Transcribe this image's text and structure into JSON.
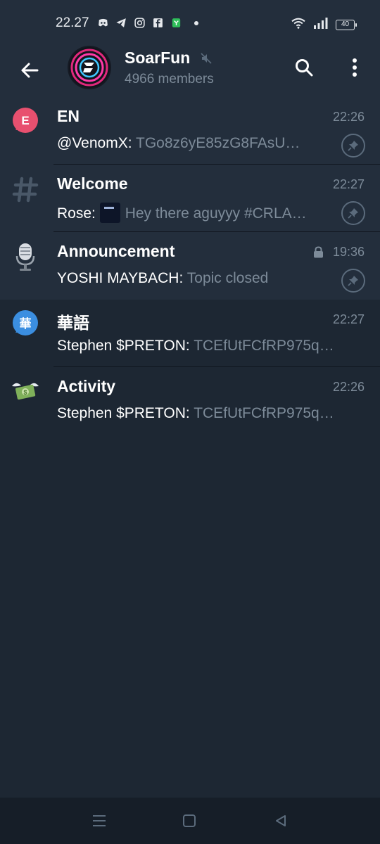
{
  "status_bar": {
    "time": "22.27",
    "left_icons": [
      "discord-icon",
      "telegram-icon",
      "instagram-icon",
      "facebook-icon",
      "app-icon"
    ],
    "battery": "40"
  },
  "header": {
    "title": "SoarFun",
    "members": "4966 members"
  },
  "topics": [
    {
      "title": "EN",
      "time": "22:26",
      "sender": "@VenomX:",
      "message": "TGo8z6yE85zG8FAsU…",
      "pinned": true,
      "icon": "en-bubble-icon",
      "icon_color": "#e8506f",
      "icon_letter": "E"
    },
    {
      "title": "Welcome",
      "time": "22:27",
      "sender": "Rose:",
      "message": "Hey there aguyyy #CRLA…",
      "pinned": true,
      "icon": "hash-icon"
    },
    {
      "title": "Announcement",
      "time": "19:36",
      "sender": "YOSHI MAYBACH:",
      "message": "Topic closed",
      "pinned": true,
      "locked": true,
      "icon": "microphone-icon"
    },
    {
      "title": "華語",
      "time": "22:27",
      "sender": "Stephen $PRETON:",
      "message": "TCEfUtFCfRP975q…",
      "pinned": false,
      "icon": "hua-bubble-icon",
      "icon_color": "#3b8ee0",
      "icon_letter": "華"
    },
    {
      "title": "Activity",
      "time": "22:26",
      "sender": "Stephen $PRETON:",
      "message": "TCEfUtFCfRP975q…",
      "pinned": false,
      "icon": "flying-money-icon"
    }
  ],
  "colors": {
    "background": "#1d2733",
    "header": "#232e3c",
    "secondary_text": "#7d8b99"
  }
}
